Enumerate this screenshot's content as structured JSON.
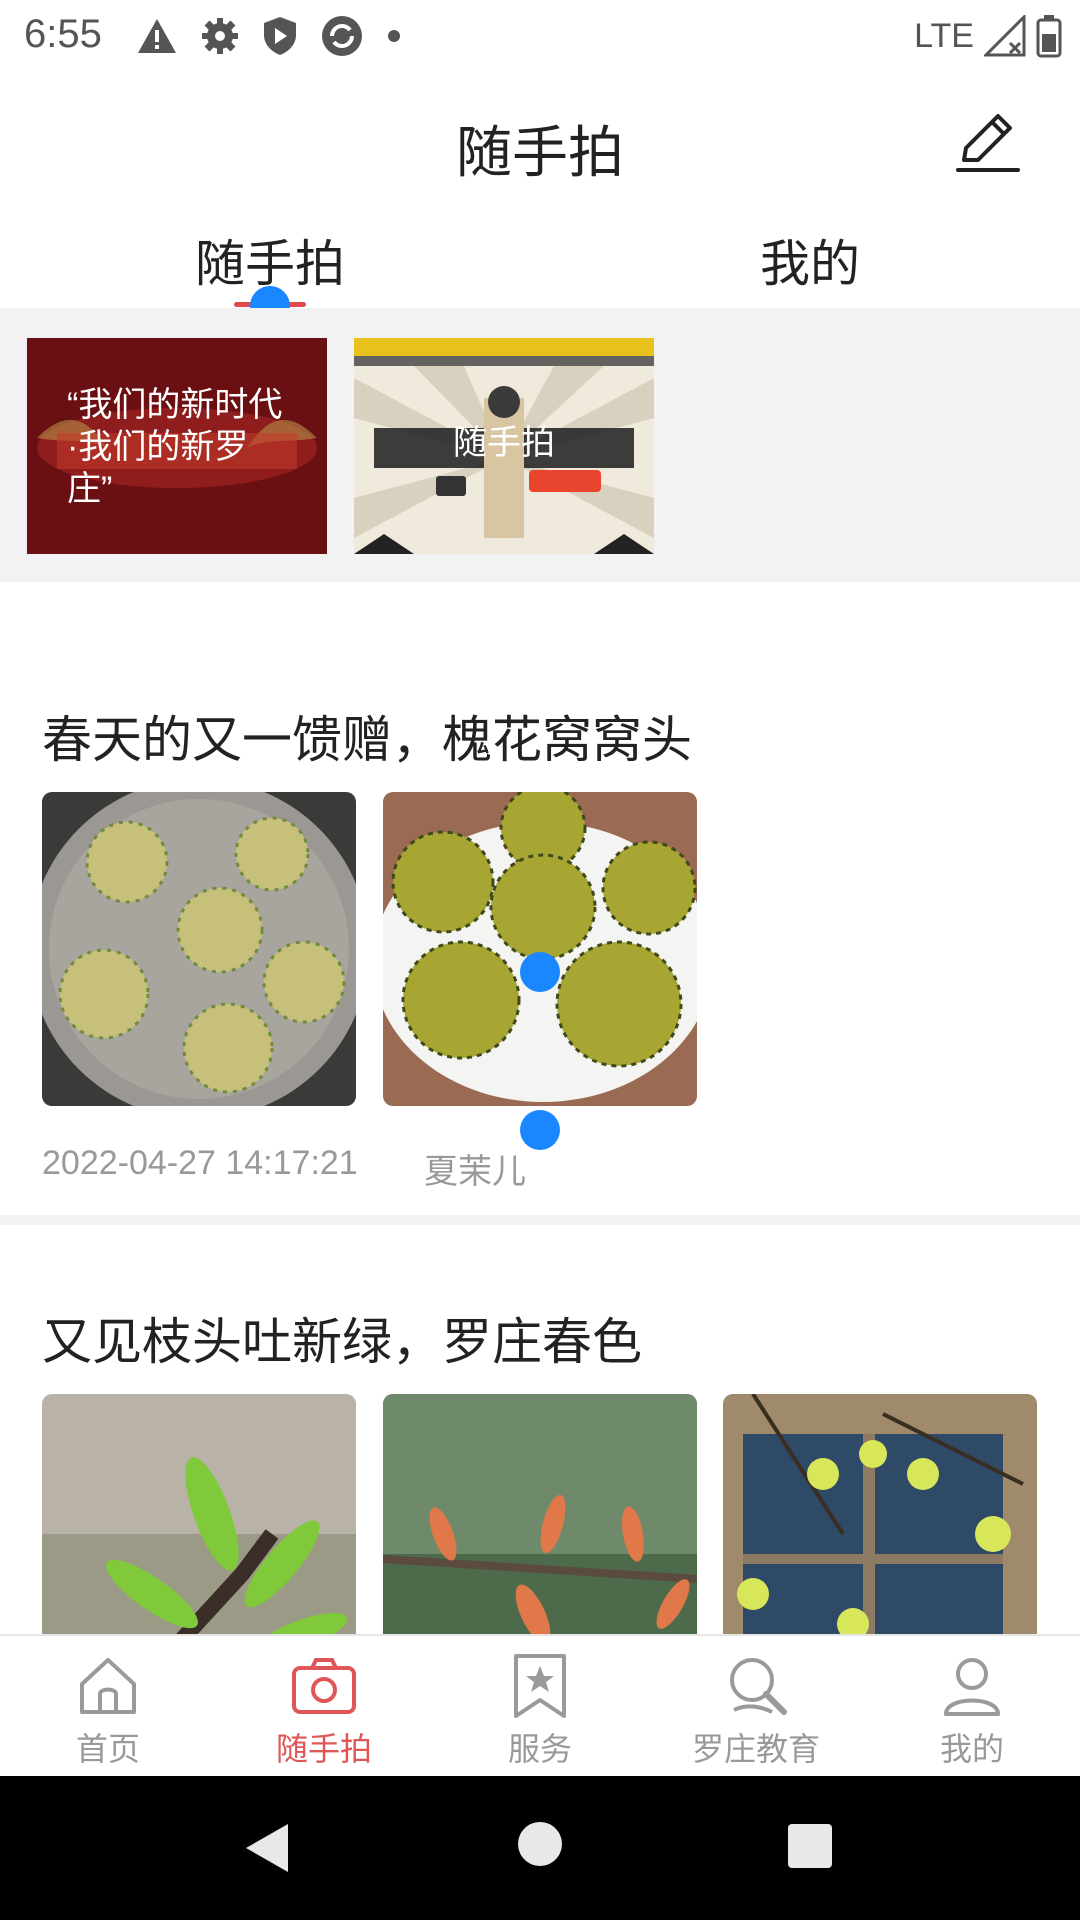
{
  "status_bar": {
    "time": "6:55",
    "network": "LTE",
    "icons": [
      "warning-icon",
      "gear-icon",
      "shield-icon",
      "sync-icon",
      "dot-icon",
      "signal-icon",
      "battery-icon"
    ]
  },
  "header": {
    "title": "随手拍",
    "edit_icon": "pencil-icon"
  },
  "tabs": [
    {
      "label": "随手拍",
      "active": true
    },
    {
      "label": "我的",
      "active": false
    }
  ],
  "banners": [
    {
      "text": "“我们的新时代·我们的新罗庄”"
    },
    {
      "text": "随手拍"
    }
  ],
  "posts": [
    {
      "title": "春天的又一馈赠，槐花窝窝头",
      "date": "2022-04-27 14:17:21",
      "author": "夏茉儿"
    },
    {
      "title": "又见枝头吐新绿，罗庄春色"
    }
  ],
  "bottom_nav": [
    {
      "label": "首页",
      "icon": "home-icon",
      "active": false
    },
    {
      "label": "随手拍",
      "icon": "camera-icon",
      "active": true
    },
    {
      "label": "服务",
      "icon": "star-bookmark-icon",
      "active": false
    },
    {
      "label": "罗庄教育",
      "icon": "education-search-icon",
      "active": false
    },
    {
      "label": "我的",
      "icon": "user-icon",
      "active": false
    }
  ],
  "colors": {
    "accent": "#e05656",
    "touch_dot": "#1a86ff",
    "inactive": "#999999"
  }
}
